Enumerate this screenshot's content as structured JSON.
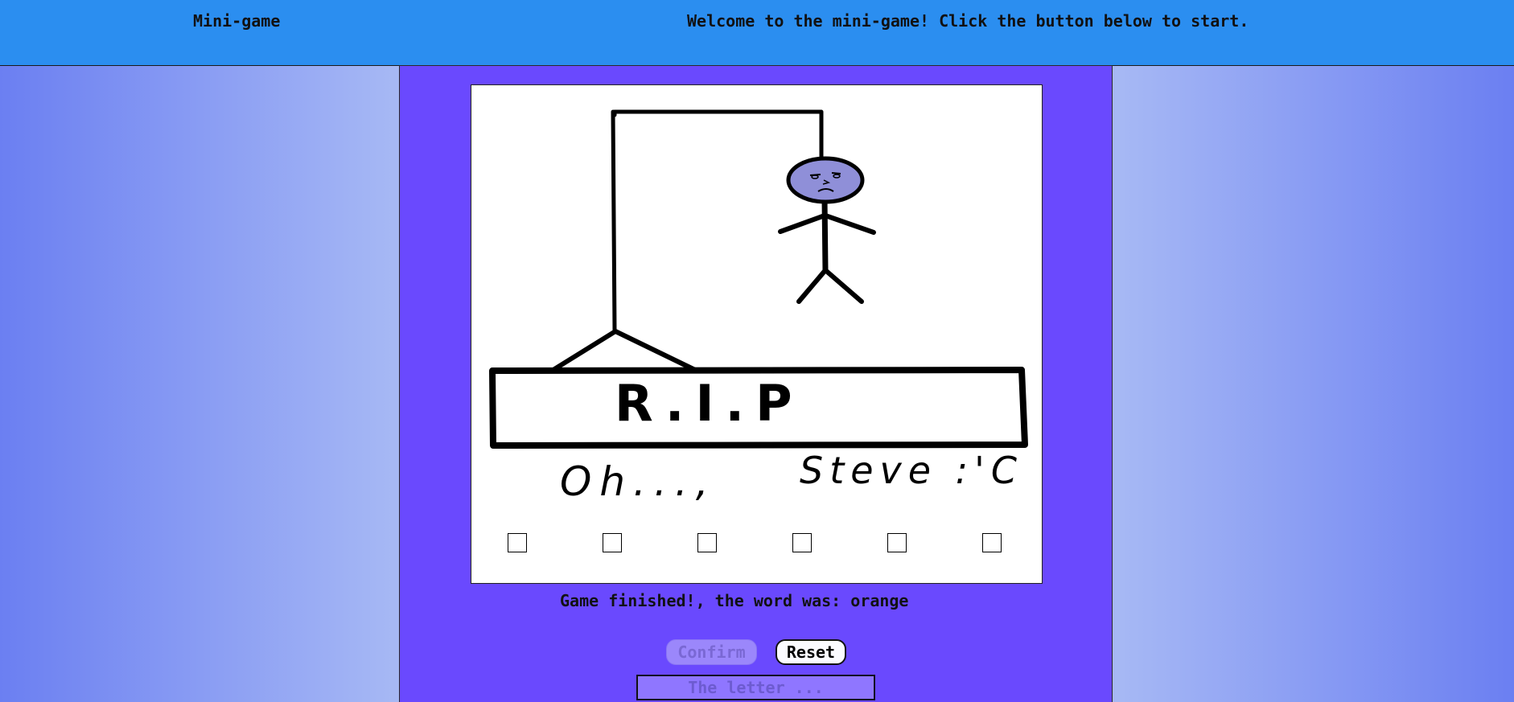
{
  "header": {
    "brand": "Mini-game",
    "welcome": "Welcome to the mini-game! Click the button below to start."
  },
  "board": {
    "slots": [
      "",
      "",
      "",
      "",
      "",
      ""
    ],
    "drawing_text": [
      "R.I.P",
      "Oh...,",
      "Steve :'C"
    ]
  },
  "status": "Game finished!, the word was: orange",
  "controls": {
    "confirm_label": "Confirm",
    "reset_label": "Reset",
    "letter_placeholder": "The letter ..."
  },
  "colors": {
    "header": "#2b8ef0",
    "panel": "#6a49fe",
    "face": "#8f8fd8"
  }
}
